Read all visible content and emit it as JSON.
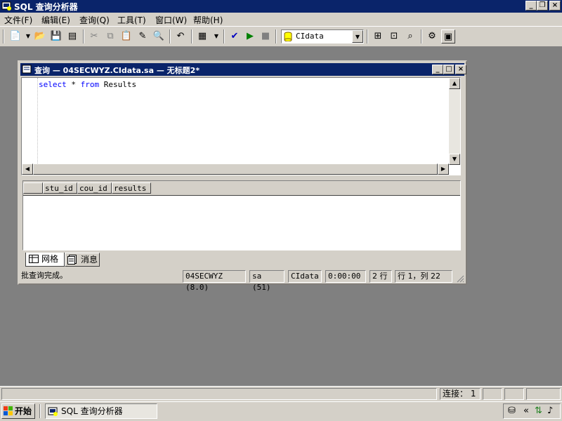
{
  "app": {
    "title": "SQL 查询分析器",
    "caption_buttons": {
      "minimize": "_",
      "restore": "❐",
      "close": "×"
    }
  },
  "menu": {
    "items": [
      "文件(F)",
      "编辑(E)",
      "查询(Q)",
      "工具(T)",
      "窗口(W)",
      "帮助(H)"
    ]
  },
  "toolbar": {
    "database": "CIdata"
  },
  "query_window": {
    "title": "查询 — 04SECWYZ.CIdata.sa — 无标题2*",
    "code": {
      "kw1": "select",
      "mid": " * ",
      "kw2": "from",
      "rest": " Results"
    },
    "columns": [
      "stu_id",
      "cou_id",
      "results"
    ],
    "tabs": {
      "grid": "网格",
      "messages": "消息"
    },
    "status": {
      "message": "批查询完成。",
      "server": "04SECWYZ (8.0)",
      "user": "sa (51)",
      "database": "CIdata",
      "time": "0:00:00",
      "rows": "2 行",
      "position": "行 1，列 22"
    }
  },
  "app_status": {
    "connections": "连接： 1"
  },
  "taskbar": {
    "start": "开始",
    "task": "SQL 查询分析器"
  },
  "colors": {
    "title_bar": "#0a246a",
    "face": "#d4d0c8",
    "mdi_bg": "#808080",
    "keyword": "#0000ff"
  }
}
